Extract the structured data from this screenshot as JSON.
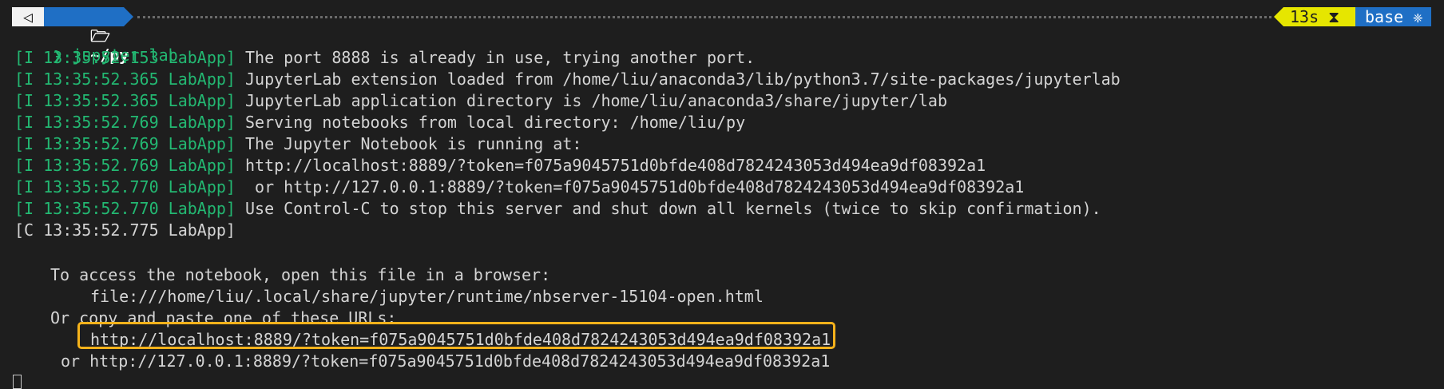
{
  "prompt_bar": {
    "os_icon": "◁",
    "dir_icon": "🗁",
    "dir": "~/py",
    "time": "13s ⧗",
    "env": "base ❈"
  },
  "command": {
    "prompt_char": "❯",
    "text": "jupyter lab"
  },
  "log_lines": [
    {
      "prefix": "[I 13:35:52.153 LabApp]",
      "message": " The port 8888 is already in use, trying another port."
    },
    {
      "prefix": "[I 13:35:52.365 LabApp]",
      "message": " JupyterLab extension loaded from /home/liu/anaconda3/lib/python3.7/site-packages/jupyterlab"
    },
    {
      "prefix": "[I 13:35:52.365 LabApp]",
      "message": " JupyterLab application directory is /home/liu/anaconda3/share/jupyter/lab"
    },
    {
      "prefix": "[I 13:35:52.769 LabApp]",
      "message": " Serving notebooks from local directory: /home/liu/py"
    },
    {
      "prefix": "[I 13:35:52.769 LabApp]",
      "message": " The Jupyter Notebook is running at:"
    },
    {
      "prefix": "[I 13:35:52.769 LabApp]",
      "message": " http://localhost:8889/?token=f075a9045751d0bfde408d7824243053d494ea9df08392a1"
    },
    {
      "prefix": "[I 13:35:52.770 LabApp]",
      "message": "  or http://127.0.0.1:8889/?token=f075a9045751d0bfde408d7824243053d494ea9df08392a1"
    },
    {
      "prefix": "[I 13:35:52.770 LabApp]",
      "message": " Use Control-C to stop this server and shut down all kernels (twice to skip confirmation)."
    },
    {
      "prefix": "",
      "message": "[C 13:35:52.775 LabApp]"
    }
  ],
  "access_block": {
    "intro": "To access the notebook, open this file in a browser:",
    "file_url": "file:///home/liu/.local/share/jupyter/runtime/nbserver-15104-open.html",
    "copy_text": "Or copy and paste one of these URLs:",
    "url_localhost": "http://localhost:8889/?token=f075a9045751d0bfde408d7824243053d494ea9df08392a1",
    "url_ip": "or http://127.0.0.1:8889/?token=f075a9045751d0bfde408d7824243053d494ea9df08392a1"
  },
  "colors": {
    "background": "#1e1e1e",
    "log_prefix": "#23b872",
    "highlight_box": "#f5b21b",
    "segment_blue": "#1f6fc5",
    "segment_yellow": "#e6e600"
  }
}
